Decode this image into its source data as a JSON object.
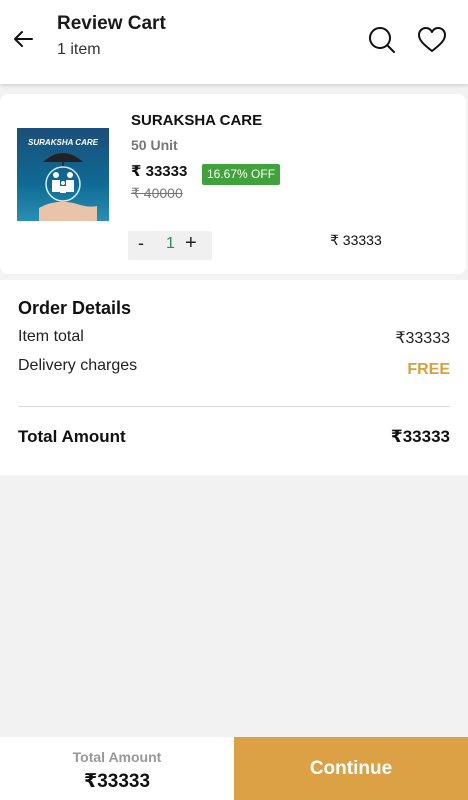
{
  "header": {
    "title": "Review Cart",
    "subtitle": "1 item",
    "icons": [
      "back-arrow-icon",
      "search-icon",
      "heart-icon"
    ]
  },
  "cart": {
    "items": [
      {
        "image_text": "SURAKSHA CARE",
        "name": "SURAKSHA CARE",
        "unit": "50 Unit",
        "price": "₹ 33333",
        "discount": "16.67% OFF",
        "mrp": "₹ 40000",
        "qty_minus": "-",
        "qty": "1",
        "qty_plus": "+",
        "line_total": "₹ 33333"
      }
    ]
  },
  "order_details": {
    "title": "Order Details",
    "item_total_label": "Item total",
    "item_total_value": "₹33333",
    "delivery_label": "Delivery charges",
    "delivery_value": "FREE",
    "total_label": "Total Amount",
    "total_value": "₹33333"
  },
  "footer": {
    "total_label": "Total Amount",
    "total_value": "₹33333",
    "continue_label": "Continue"
  },
  "colors": {
    "accent": "#dba144",
    "discount_badge": "#3fa23a",
    "free_text": "#d9a03d",
    "qty_value": "#2e8b57"
  }
}
